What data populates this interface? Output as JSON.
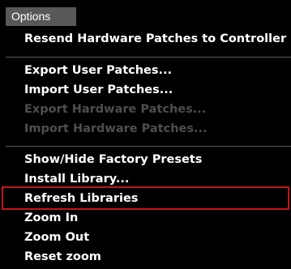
{
  "menu": {
    "title": "Options",
    "items": [
      {
        "label": "Resend Hardware Patches to Controller",
        "enabled": true
      },
      {
        "label": "Export User Patches...",
        "enabled": true
      },
      {
        "label": "Import User Patches...",
        "enabled": true
      },
      {
        "label": "Export Hardware Patches...",
        "enabled": false
      },
      {
        "label": "Import Hardware Patches...",
        "enabled": false
      },
      {
        "label": "Show/Hide Factory Presets",
        "enabled": true
      },
      {
        "label": "Install Library...",
        "enabled": true
      },
      {
        "label": "Refresh Libraries",
        "enabled": true,
        "highlighted": true
      },
      {
        "label": "Zoom In",
        "enabled": true
      },
      {
        "label": "Zoom Out",
        "enabled": true
      },
      {
        "label": "Reset zoom",
        "enabled": true
      }
    ]
  },
  "colors": {
    "background": "#000000",
    "tab_background": "#585858",
    "text": "#ffffff",
    "disabled_text": "#4e4e4e",
    "separator": "#5c5c5c",
    "highlight_border": "#c0161a"
  }
}
